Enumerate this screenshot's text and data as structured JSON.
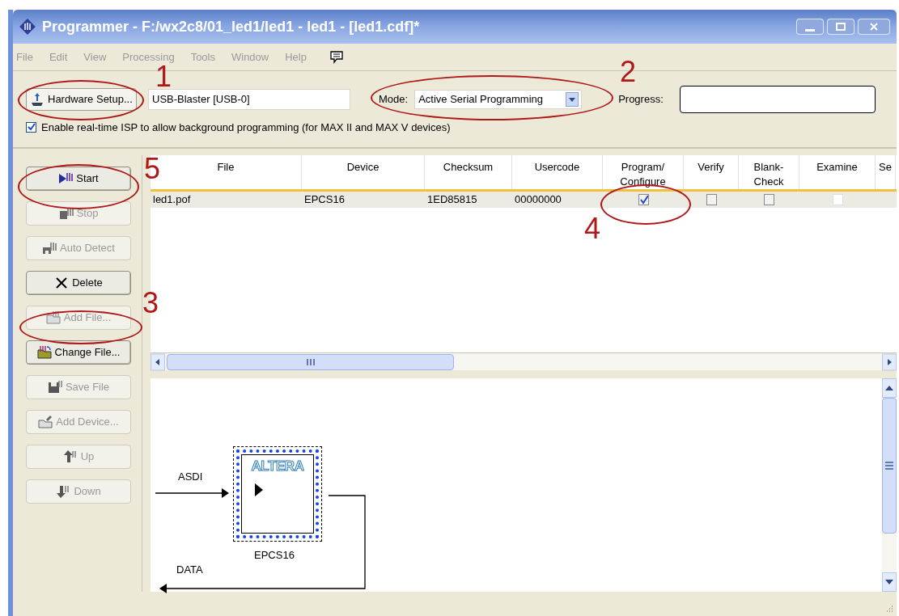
{
  "window": {
    "title": "Programmer - F:/wx2c8/01_led1/led1 - led1 - [led1.cdf]*"
  },
  "menu": [
    "File",
    "Edit",
    "View",
    "Processing",
    "Tools",
    "Window",
    "Help"
  ],
  "toolbar": {
    "hardware_button": "Hardware Setup...",
    "hardware_value": "USB-Blaster [USB-0]",
    "mode_label": "Mode:",
    "mode_value": "Active Serial Programming",
    "progress_label": "Progress:",
    "progress_bar": {
      "level": 0
    },
    "isp_option": {
      "label": "Enable real-time ISP to allow background programming (for MAX II and MAX V devices)",
      "checked": true
    }
  },
  "side_buttons": [
    {
      "kind": "start",
      "label": "Start",
      "disabled": false
    },
    {
      "kind": "stop",
      "label": "Stop",
      "disabled": true
    },
    {
      "kind": "detect",
      "label": "Auto Detect",
      "disabled": true
    },
    {
      "kind": "delete",
      "label": "Delete",
      "disabled": false
    },
    {
      "kind": "add",
      "label": "Add File...",
      "disabled": true
    },
    {
      "kind": "change",
      "label": "Change File...",
      "disabled": false
    },
    {
      "kind": "save",
      "label": "Save File",
      "disabled": true
    },
    {
      "kind": "device",
      "label": "Add Device...",
      "disabled": true
    },
    {
      "kind": "up",
      "label": "Up",
      "disabled": true
    },
    {
      "kind": "down",
      "label": "Down",
      "disabled": true
    }
  ],
  "table": {
    "columns": [
      "File",
      "Device",
      "Checksum",
      "Usercode",
      "Program/ Configure",
      "Verify",
      "Blank- Check",
      "Examine",
      "Se"
    ],
    "rows": [
      {
        "file": "led1.pof",
        "device": "EPCS16",
        "checksum": "1ED85815",
        "usercode": "00000000",
        "checks": [
          {
            "checked": true,
            "disabled": false
          },
          {
            "checked": false,
            "disabled": false
          },
          {
            "checked": false,
            "disabled": false
          },
          {
            "checked": false,
            "disabled": true
          }
        ]
      }
    ]
  },
  "diagram": {
    "input_label": "ASDI",
    "output_label": "DATA",
    "chip_logo": "ALTERA",
    "chip_name": "EPCS16"
  },
  "annotations": [
    "1",
    "2",
    "3",
    "4",
    "5"
  ]
}
